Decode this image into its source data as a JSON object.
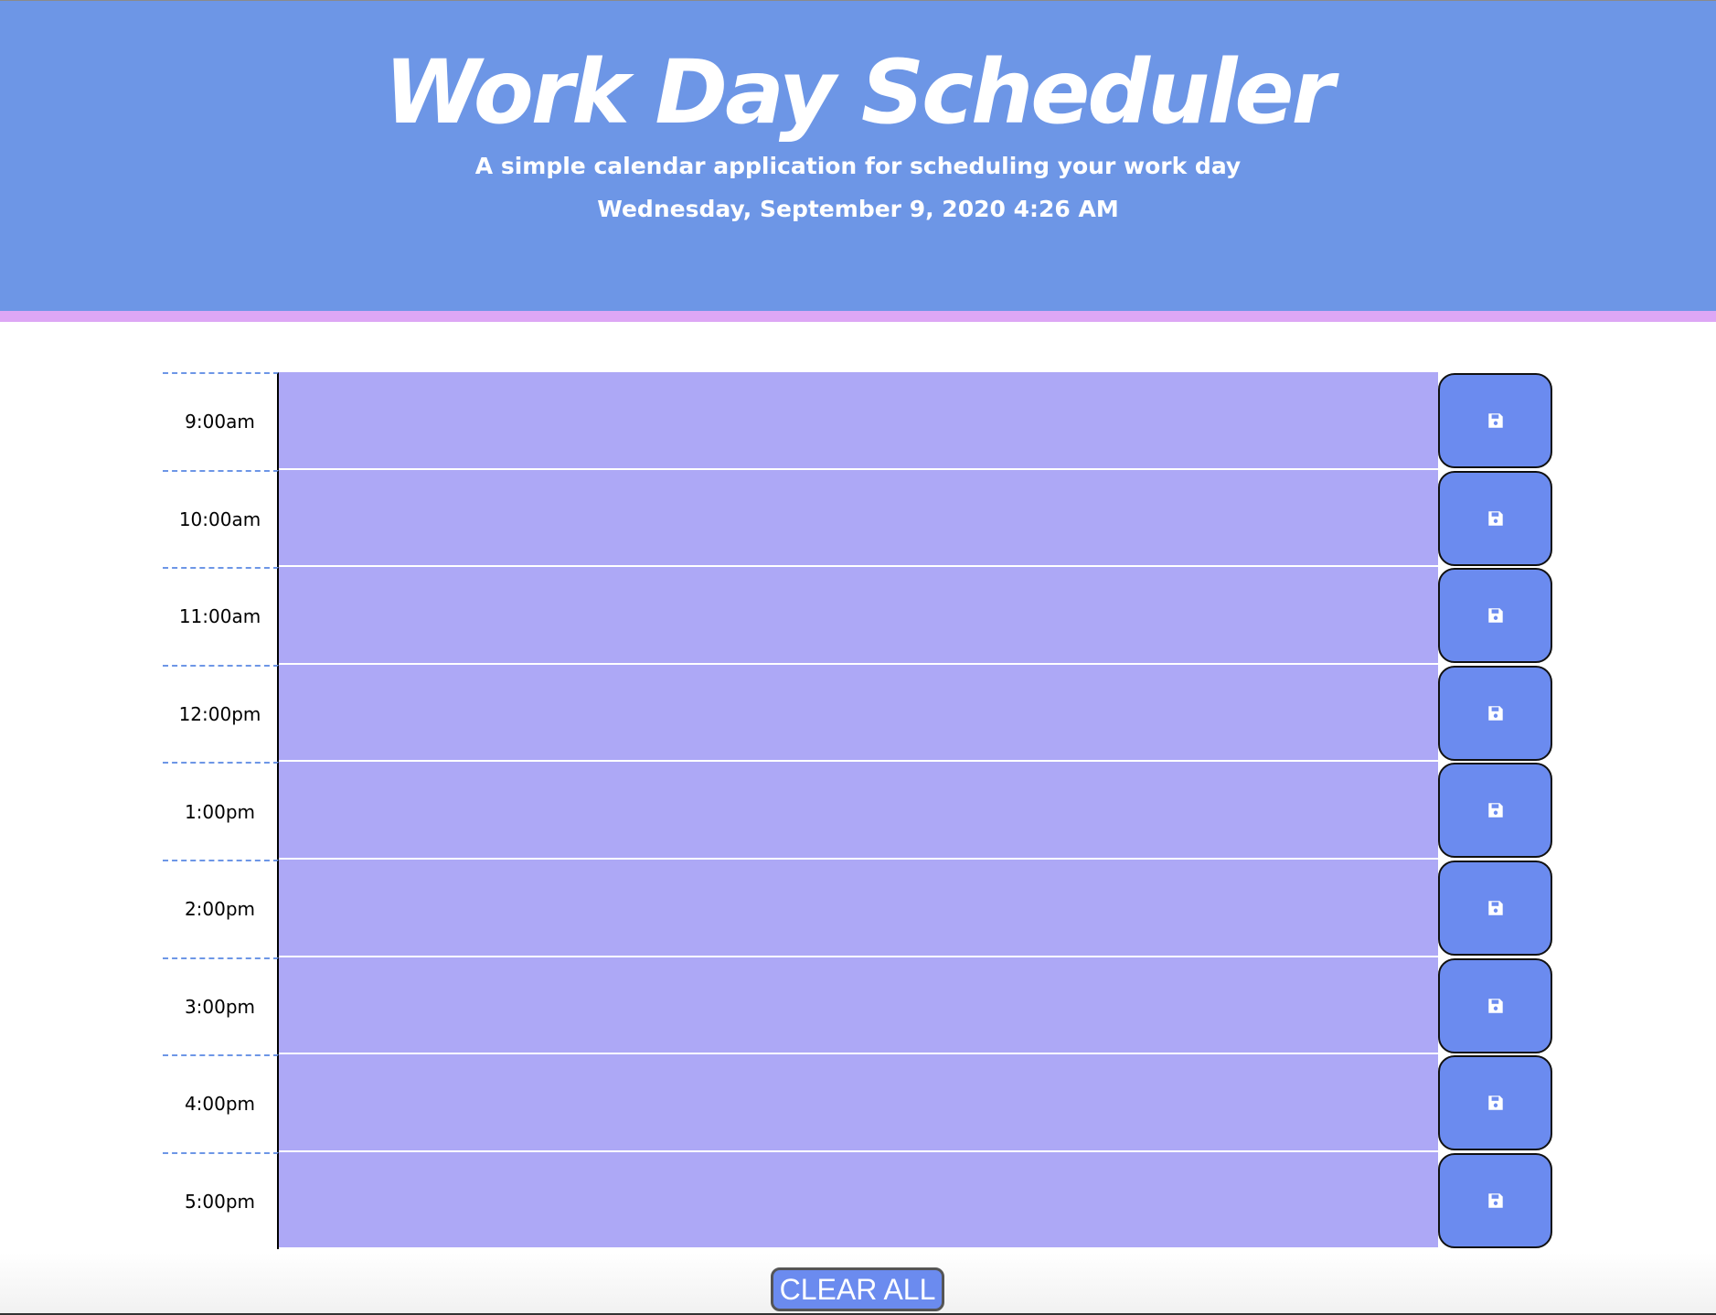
{
  "header": {
    "title": "Work Day Scheduler",
    "subtitle": "A simple calendar application for scheduling your work day",
    "current_day": "Wednesday, September 9, 2020 4:26 AM"
  },
  "time_blocks": [
    {
      "hour": "9:00am",
      "text": ""
    },
    {
      "hour": "10:00am",
      "text": ""
    },
    {
      "hour": "11:00am",
      "text": ""
    },
    {
      "hour": "12:00pm",
      "text": ""
    },
    {
      "hour": "1:00pm",
      "text": ""
    },
    {
      "hour": "2:00pm",
      "text": ""
    },
    {
      "hour": "3:00pm",
      "text": ""
    },
    {
      "hour": "4:00pm",
      "text": ""
    },
    {
      "hour": "5:00pm",
      "text": ""
    }
  ],
  "save_icon": "floppy-disk-icon",
  "footer": {
    "clear_label": "CLEAR ALL"
  },
  "colors": {
    "header_bg": "#6d96e6",
    "header_stripe": "#dda7f5",
    "block_bg": "#ada8f6",
    "button_bg": "#6b8bef"
  }
}
